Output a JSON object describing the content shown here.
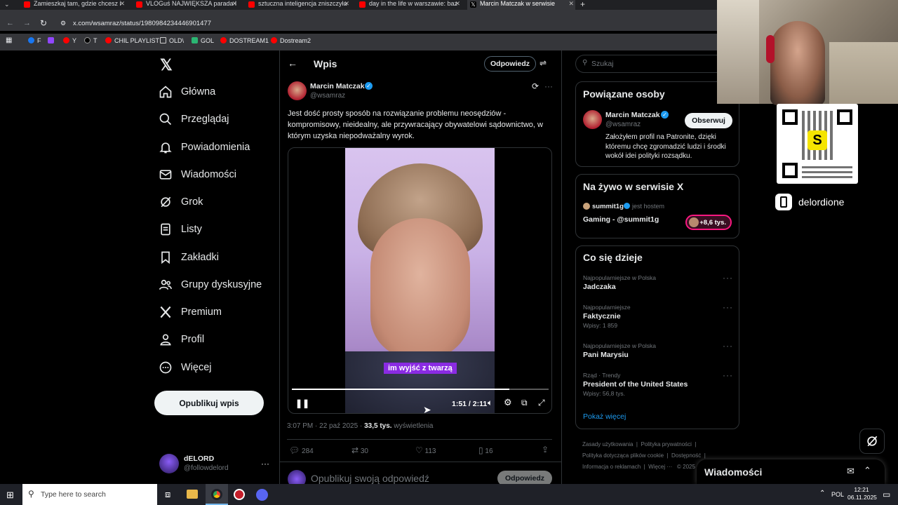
{
  "browser": {
    "tabs": [
      {
        "label": "Zamieszkaj tam, gdzie chcesz i"
      },
      {
        "label": "VLOGuś NAJWIĘKSZA parada l"
      },
      {
        "label": "sztuczna inteligencja zniszczyła"
      },
      {
        "label": "day in the life w warszawie: baz"
      },
      {
        "label": "Marcin Matczak w serwisie"
      }
    ],
    "url": "x.com/wsamraz/status/1980984234446901477",
    "bookmarks": [
      "F",
      "Y",
      "T",
      "CHIL PLAYLIST",
      "OLD\\",
      "GOL",
      "DOSTREAM1",
      "Dostream2"
    ]
  },
  "nav": {
    "items": [
      "Główna",
      "Przeglądaj",
      "Powiadomienia",
      "Wiadomości",
      "Grok",
      "Listy",
      "Zakładki",
      "Grupy dyskusyjne",
      "Premium",
      "Profil",
      "Więcej"
    ],
    "post_button": "Opublikuj wpis",
    "account_name": "dELORD",
    "account_handle": "@followdelord"
  },
  "post": {
    "header_title": "Wpis",
    "reply_button": "Odpowiedz",
    "author_name": "Marcin Matczak",
    "author_handle": "@wsamraz",
    "text": "Jest dość prosty sposób na rozwiązanie problemu neosędziów - kompromisowy, nieidealny, ale przywracający obywatelowi sądownictwo, w którym uzyska niepodważalny wyrok.",
    "video_caption": "im wyjść z twarzą",
    "video_time": "1:51 / 2:11",
    "video_progress": 0.847,
    "timestamp": "3:07 PM · 22 paź 2025 ·",
    "views": "33,5 tys.",
    "views_label": "wyświetlenia",
    "stats": {
      "replies": "284",
      "reposts": "30",
      "likes": "113",
      "bookmarks": "16"
    },
    "compose_placeholder": "Opublikuj swoją odpowiedź",
    "compose_button": "Odpowiedz"
  },
  "sidebar": {
    "search_placeholder": "Szukaj",
    "related_title": "Powiązane osoby",
    "related_name": "Marcin Matczak",
    "related_handle": "@wsamraz",
    "follow_button": "Obserwuj",
    "related_bio": "Założyłem profil na Patronite, dzięki któremu chcę zgromadzić ludzi i środki wokół idei polityki rozsądku.",
    "live_title": "Na żywo w serwisie X",
    "live_host": "summit1g",
    "live_host_label": "jest hostem",
    "live_name": "Gaming - @summit1g",
    "live_count": "+8,6 tys.",
    "trends_title": "Co się dzieje",
    "trends": [
      {
        "context": "Najpopularniejsze w Polska",
        "name": "Jadczaka",
        "count": ""
      },
      {
        "context": "Najpopularniejsze",
        "name": "Faktycznie",
        "count": "Wpisy: 1 859"
      },
      {
        "context": "Najpopularniejsze w Polska",
        "name": "Pani Marysiu",
        "count": ""
      },
      {
        "context": "Rząd · Trendy",
        "name": "President of the United States",
        "count": "Wpisy: 56,8 tys."
      }
    ],
    "show_more": "Pokaż więcej",
    "footer_links": [
      "Zasady użytkowania",
      "Polityka prywatności",
      "Polityka dotycząca plików cookie",
      "Dostępność",
      "Informacja o reklamach",
      "Więcej ···",
      "© 2025"
    ],
    "messages_title": "Wiadomości"
  },
  "stream": {
    "channel": "delordione"
  },
  "taskbar": {
    "search_placeholder": "Type here to search",
    "lang": "POL",
    "time": "12:21",
    "date": "06.11.2025"
  },
  "colors": {
    "accent": "#1d9bf0",
    "caption_bg": "#8a2be2",
    "qr_yellow": "#f5e400"
  }
}
